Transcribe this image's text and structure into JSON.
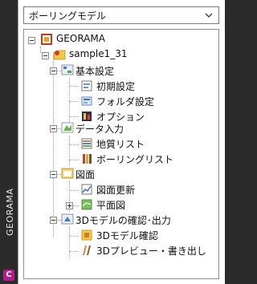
{
  "rail": {
    "title": "GEORAMA",
    "app_icon_letter": "C"
  },
  "dropdown": {
    "value": "ボーリングモデル"
  },
  "tree": {
    "root": "GEORAMA",
    "project": "sample1_31",
    "groups": [
      {
        "label": "基本設定",
        "items": [
          "初期設定",
          "フォルダ設定",
          "オプション"
        ]
      },
      {
        "label": "データ入力",
        "items": [
          "地質リスト",
          "ボーリングリスト"
        ]
      },
      {
        "label": "図面",
        "items": [
          "図面更新",
          "平面図"
        ]
      },
      {
        "label": "3Dモデルの確認･出力",
        "items": [
          "3Dモデル確認",
          "3Dプレビュー・書き出し"
        ]
      }
    ]
  }
}
